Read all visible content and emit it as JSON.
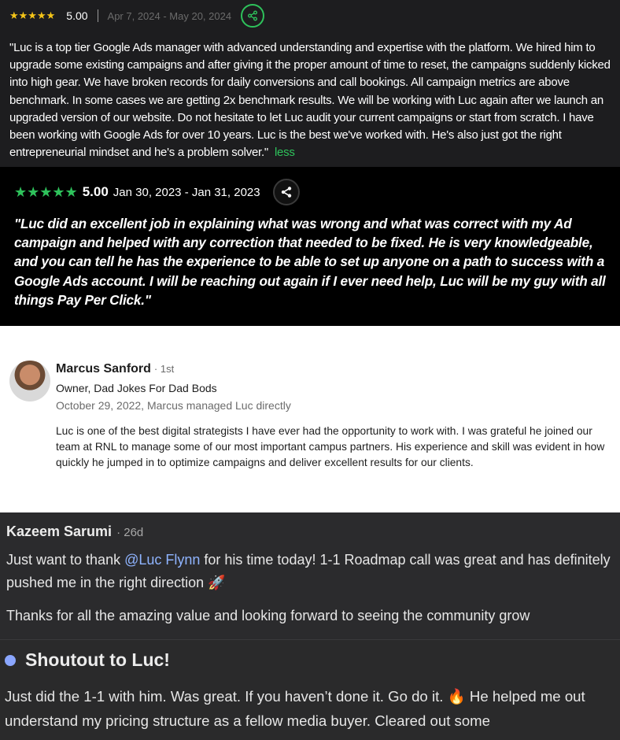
{
  "review1": {
    "stars": "★★★★★",
    "rating": "5.00",
    "dates": "Apr 7, 2024 - May 20, 2024",
    "icon": "share-icon",
    "text": "\"Luc is a top tier Google Ads manager with advanced understanding and expertise with the platform. We hired him to upgrade some existing campaigns and after giving it the proper amount of time to reset, the campaigns suddenly kicked into high gear. We have broken records for daily conversions and call bookings. All campaign metrics are above benchmark. In some cases we are getting 2x benchmark results. We will be working with Luc again after we launch an upgraded version of our website. Do not hesitate to let Luc audit your current campaigns or start from scratch. I have been working with Google Ads for over 10 years. Luc is the best we've worked with. He's also just got the right entrepreneurial mindset and he's a problem solver.\"",
    "less_label": "less",
    "star_color": "#f5c518",
    "accent": "#2ec25b"
  },
  "review2": {
    "stars": "★★★★★",
    "rating": "5.00",
    "dates": "Jan 30, 2023 - Jan 31, 2023",
    "icon": "share-icon",
    "text": "\"Luc did an excellent job in explaining what was wrong and what was correct with my Ad campaign and helped with any correction that needed to be fixed. He is very knowledgeable, and you can tell he has the experience to be able to set up anyone on a path to success with a Google Ads account. I will be reaching out again if I ever need help, Luc will be my guy with all things Pay Per Click.\""
  },
  "recommendation": {
    "name": "Marcus Sanford",
    "degree": "· 1st",
    "title": "Owner, Dad Jokes For Dad Bods",
    "meta": "October 29, 2022, Marcus managed Luc directly",
    "text": "Luc is one of the best digital strategists I have ever had the opportunity to work with. I was grateful he joined our team at RNL to manage some of our most important campus partners. His experience and skill was evident in how quickly he jumped in to optimize campaigns and deliver excellent results for our clients."
  },
  "comment1": {
    "name": "Kazeem Sarumi",
    "age": "· 26d",
    "text_before": "Just want to thank ",
    "mention": "@Luc Flynn",
    "text_after": " for his time today! 1-1 Roadmap call was great and has definitely pushed me in the right direction 🚀",
    "text2": "Thanks for all the amazing value and looking forward to seeing the community grow"
  },
  "comment2": {
    "title": "Shoutout to Luc!",
    "text": "Just did the 1-1 with him. Was great. If you haven’t done it. Go do it. 🔥 He helped me out understand my pricing structure as a fellow media buyer. Cleared out some"
  }
}
